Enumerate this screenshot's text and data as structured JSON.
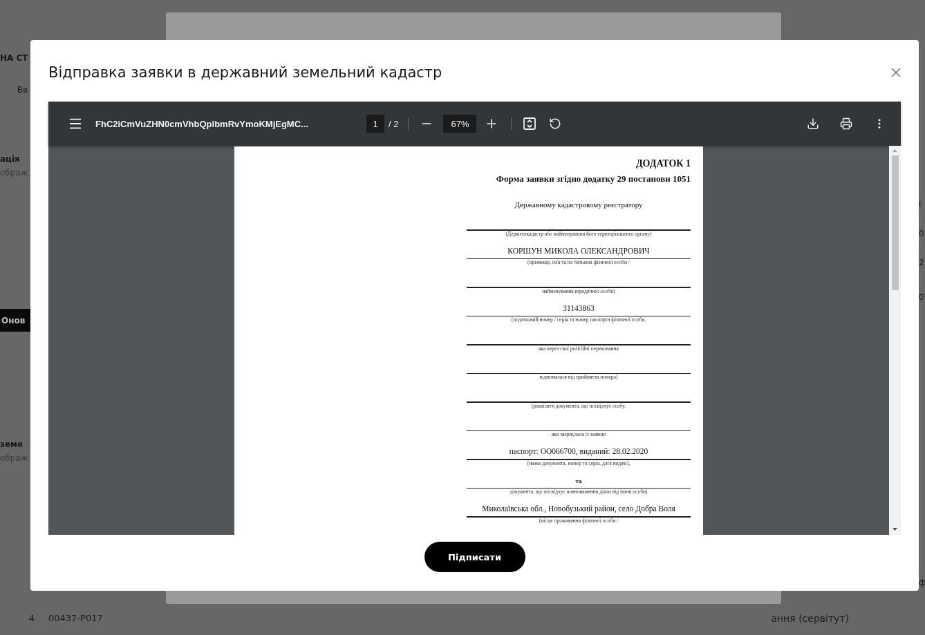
{
  "background_page": {
    "left_fragments": [
      {
        "kind": "heading",
        "text": "НА СТ"
      },
      {
        "kind": "text",
        "text": "Вв"
      },
      {
        "kind": "heading",
        "text": "ація"
      },
      {
        "kind": "subtitle",
        "text": "ображ"
      },
      {
        "kind": "button",
        "text": "Онов"
      },
      {
        "kind": "heading",
        "text": "земе"
      },
      {
        "kind": "subtitle",
        "text": "ображ"
      }
    ],
    "right_fragments": [
      "і",
      "0",
      "2",
      "0",
      "ф"
    ],
    "row": {
      "number": "4",
      "code": "00437-P017",
      "type": "ання (сервітут)"
    }
  },
  "dialog": {
    "title": "Відправка заявки в державний земельний кадастр",
    "viewer": {
      "file_name": "FhC2iCmVuZHN0cmVhbQplbmRvYmoKMjEgMC...",
      "page_current": "1",
      "page_total": "/ 2",
      "zoom": "67%"
    },
    "document": {
      "annex": "ДОДАТОК 1",
      "form_title": "Форма заявки згідно додатку 29 постанови 1051",
      "items": [
        {
          "kind": "text",
          "text": "Державному кадастровому реєстратору"
        },
        {
          "kind": "field",
          "caption": "(Держгеокадастр або найменування його територіального органу)"
        },
        {
          "kind": "field",
          "value": "КОРШУН МИКОЛА ОЛЕКСАНДРОВИЧ",
          "caption": "(прізвище, ім'я та по батькові фізичної особи /"
        },
        {
          "kind": "field",
          "caption": "найменування юридичної особи)"
        },
        {
          "kind": "field",
          "value": "31143863",
          "caption": "(податковий номер / серія та номер паспорта фізичної особи,"
        },
        {
          "kind": "field",
          "caption": "яка через свої релігійні переконання"
        },
        {
          "kind": "field",
          "caption": "відмовилася від прийняття номера)"
        },
        {
          "kind": "field",
          "caption": "(реквізити документа, що посвідчує особу,"
        },
        {
          "kind": "field",
          "caption": "яка звернулася із заявою"
        },
        {
          "kind": "field",
          "value": "паспорт: ОО066700, виданий: 28.02.2020",
          "caption": "(назва документа, номер та серія, дата видачі),"
        },
        {
          "kind": "bold-field",
          "value": "та",
          "caption": "документа, що посвідчує повноваження діяти від імені особи)"
        },
        {
          "kind": "field",
          "value": "Миколаївська обл., Новобузький район, село Добра Воля",
          "caption": "(місце проживання фізичної особи /"
        }
      ]
    },
    "sign_button": "Підписати"
  }
}
